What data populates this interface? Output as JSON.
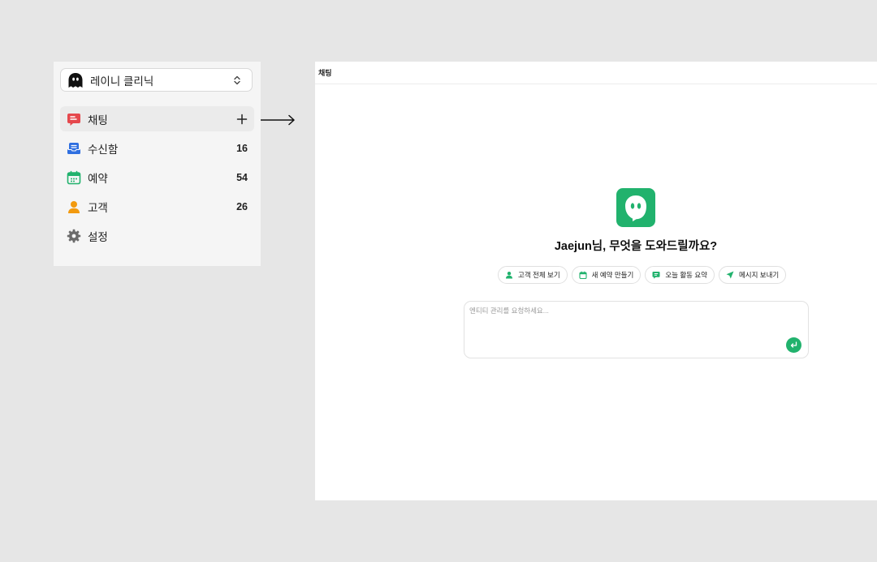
{
  "sidebar": {
    "workspace": {
      "name": "레이니 클리닉",
      "avatar_icon": "ghost-avatar-icon",
      "switch_icon": "chevron-up-down-icon"
    },
    "items": [
      {
        "label": "채팅",
        "icon": "chat-icon",
        "icon_color": "#e5484d",
        "active": true,
        "action_icon": "plus-icon"
      },
      {
        "label": "수신함",
        "icon": "inbox-icon",
        "icon_color": "#2f6fe0",
        "count": "16"
      },
      {
        "label": "예약",
        "icon": "calendar-icon",
        "icon_color": "#21b26d",
        "count": "54"
      },
      {
        "label": "고객",
        "icon": "person-icon",
        "icon_color": "#f29a0f",
        "count": "26"
      },
      {
        "label": "설정",
        "icon": "gear-icon",
        "icon_color": "#6b6b6b"
      }
    ]
  },
  "main": {
    "title": "채팅",
    "logo_icon": "ghost-logo-icon",
    "brand_color": "#21b26d",
    "greeting": "Jaejun님, 무엇을 도와드릴까요?",
    "chips": [
      {
        "label": "고객 전체 보기",
        "icon": "person-icon"
      },
      {
        "label": "새 예약 만들기",
        "icon": "calendar-icon"
      },
      {
        "label": "오늘 활동 요약",
        "icon": "message-icon"
      },
      {
        "label": "메시지 보내기",
        "icon": "send-icon"
      }
    ],
    "composer": {
      "placeholder": "엔티티 관리를 요청하세요...",
      "value": "",
      "send_icon": "enter-icon"
    }
  }
}
